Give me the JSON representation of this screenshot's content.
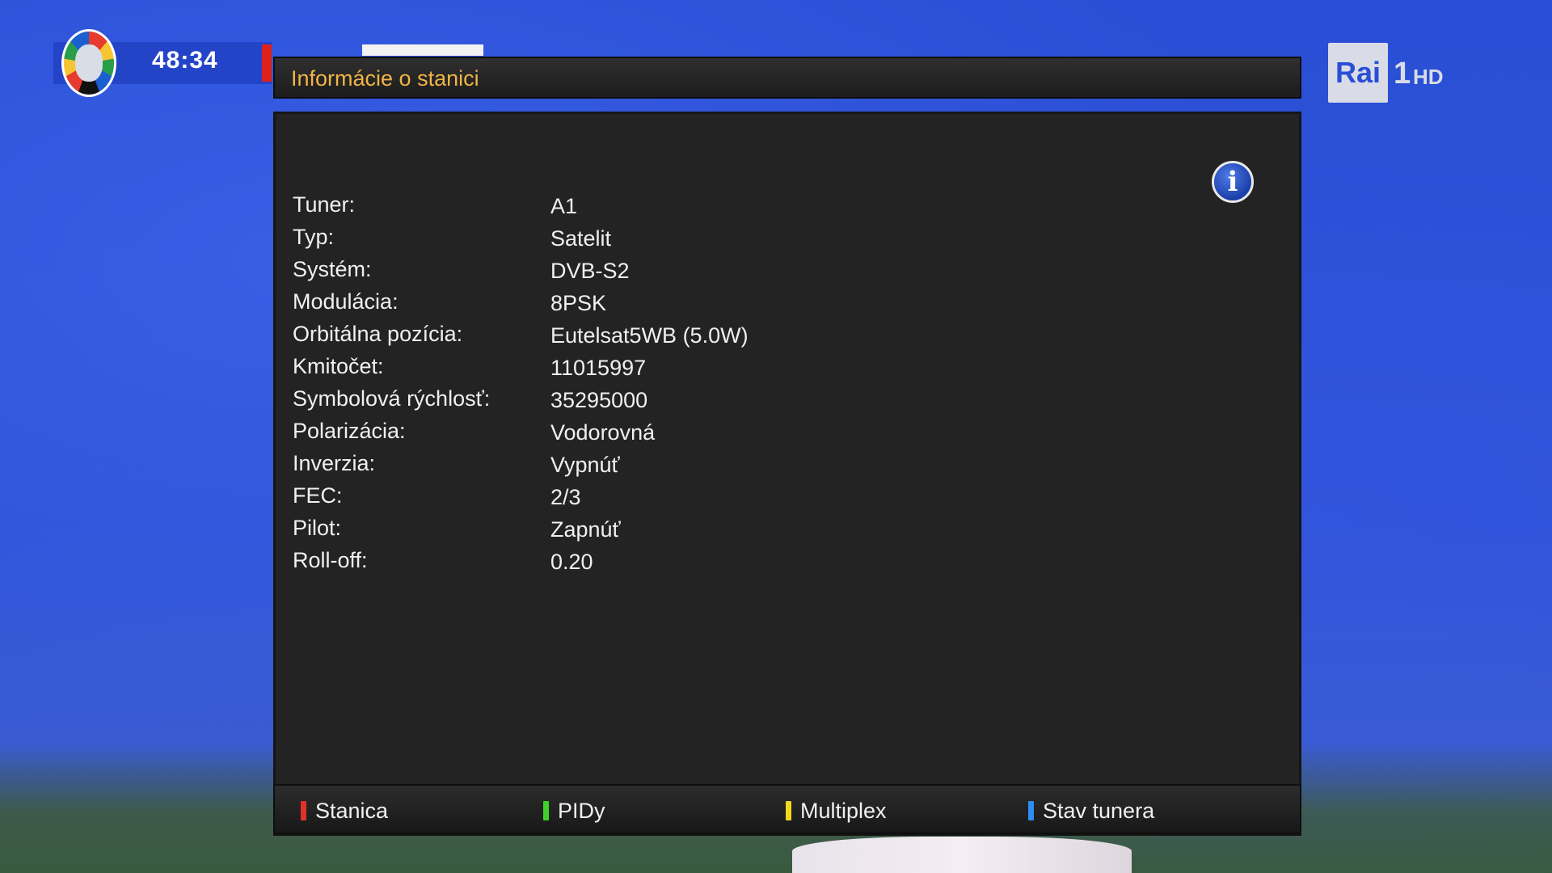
{
  "broadcast": {
    "match_clock": "48:34",
    "channel_logo": "Rai",
    "channel_number": "1",
    "channel_hd": "HD"
  },
  "dialog": {
    "title": "Informácie o stanici",
    "rows": [
      {
        "label": "Tuner:",
        "value": "A1"
      },
      {
        "label": "Typ:",
        "value": "Satelit"
      },
      {
        "label": "Systém:",
        "value": "DVB-S2"
      },
      {
        "label": "Modulácia:",
        "value": "8PSK"
      },
      {
        "label": "Orbitálna pozícia:",
        "value": "Eutelsat5WB (5.0W)"
      },
      {
        "label": "Kmitočet:",
        "value": "11015997"
      },
      {
        "label": "Symbolová rýchlosť:",
        "value": "35295000"
      },
      {
        "label": "Polarizácia:",
        "value": "Vodorovná"
      },
      {
        "label": "Inverzia:",
        "value": "Vypnúť"
      },
      {
        "label": "FEC:",
        "value": "2/3"
      },
      {
        "label": "Pilot:",
        "value": "Zapnúť"
      },
      {
        "label": "Roll-off:",
        "value": "0.20"
      }
    ],
    "info_icon": "info-icon"
  },
  "footer": {
    "buttons": [
      {
        "label": "Stanica",
        "color": "#e0302a"
      },
      {
        "label": "PIDy",
        "color": "#3fd12a"
      },
      {
        "label": "Multiplex",
        "color": "#f1d81f"
      },
      {
        "label": "Stav tunera",
        "color": "#2d8df0"
      }
    ]
  },
  "colors": {
    "title_accent": "#f1b445",
    "panel_bg": "#232323"
  }
}
